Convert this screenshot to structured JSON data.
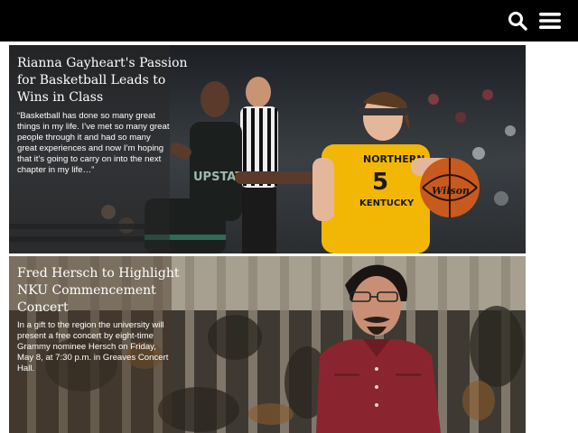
{
  "header": {
    "search_icon": "search-icon",
    "menu_icon": "hamburger-menu-icon",
    "background": "#000000"
  },
  "stories": [
    {
      "headline": "Rianna Gayheart's Passion for Basketball Leads to Wins in Class",
      "blurb": "“Basketball has done so many great things in my life. I’ve met so many great people through it and had so many great experiences and now I’m hoping that it’s going to carry on into the next chapter in my life…”",
      "jersey_left": "UPSTATE",
      "jersey_right": "NORTHERN KENTUCKY",
      "jersey_number": "5",
      "ball_brand": "Wilson"
    },
    {
      "headline": "Fred Hersch to Highlight NKU Commencement Concert",
      "blurb": "In a gift to the region the university will present a free concert by eight-time Grammy nominee Hersch on Friday, May 8, at 7:30 p.m. in Greaves Concert Hall."
    }
  ],
  "colors": {
    "nku_gold": "#f2b705",
    "upstate_dark": "#1b1f1e",
    "shirt_red": "#8a2530"
  }
}
